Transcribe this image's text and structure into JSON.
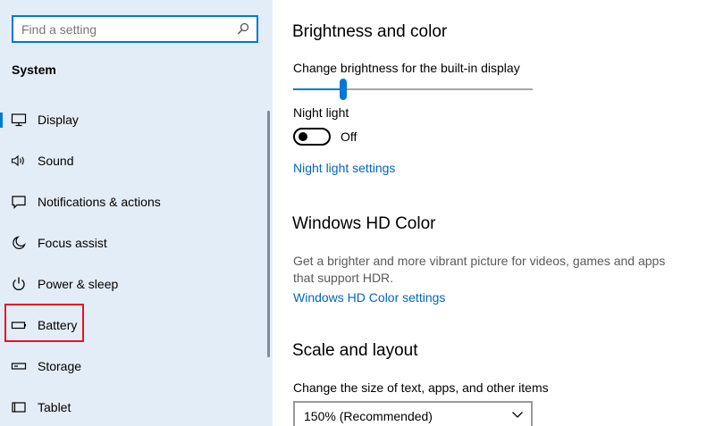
{
  "search": {
    "placeholder": "Find a setting"
  },
  "sidebar": {
    "heading": "System",
    "items": [
      {
        "label": "Display",
        "icon": "monitor-icon",
        "selected": true
      },
      {
        "label": "Sound",
        "icon": "speaker-icon"
      },
      {
        "label": "Notifications & actions",
        "icon": "notification-icon"
      },
      {
        "label": "Focus assist",
        "icon": "moon-icon"
      },
      {
        "label": "Power & sleep",
        "icon": "power-icon"
      },
      {
        "label": "Battery",
        "icon": "battery-icon",
        "highlighted": true
      },
      {
        "label": "Storage",
        "icon": "storage-icon"
      },
      {
        "label": "Tablet",
        "icon": "tablet-icon"
      }
    ]
  },
  "main": {
    "brightness": {
      "title": "Brightness and color",
      "slider_label": "Change brightness for the built-in display",
      "slider_value": 0.21
    },
    "night_light": {
      "label": "Night light",
      "state_label": "Off",
      "on": false,
      "settings_link": "Night light settings"
    },
    "hd_color": {
      "title": "Windows HD Color",
      "description": "Get a brighter and more vibrant picture for videos, games and apps that support HDR.",
      "settings_link": "Windows HD Color settings"
    },
    "scale": {
      "title": "Scale and layout",
      "label": "Change the size of text, apps, and other items",
      "selected": "150% (Recommended)"
    }
  },
  "colors": {
    "accent": "#0078d7",
    "link": "#0067c0",
    "sidebar_bg": "#e3edf7",
    "highlight": "#e81123"
  }
}
